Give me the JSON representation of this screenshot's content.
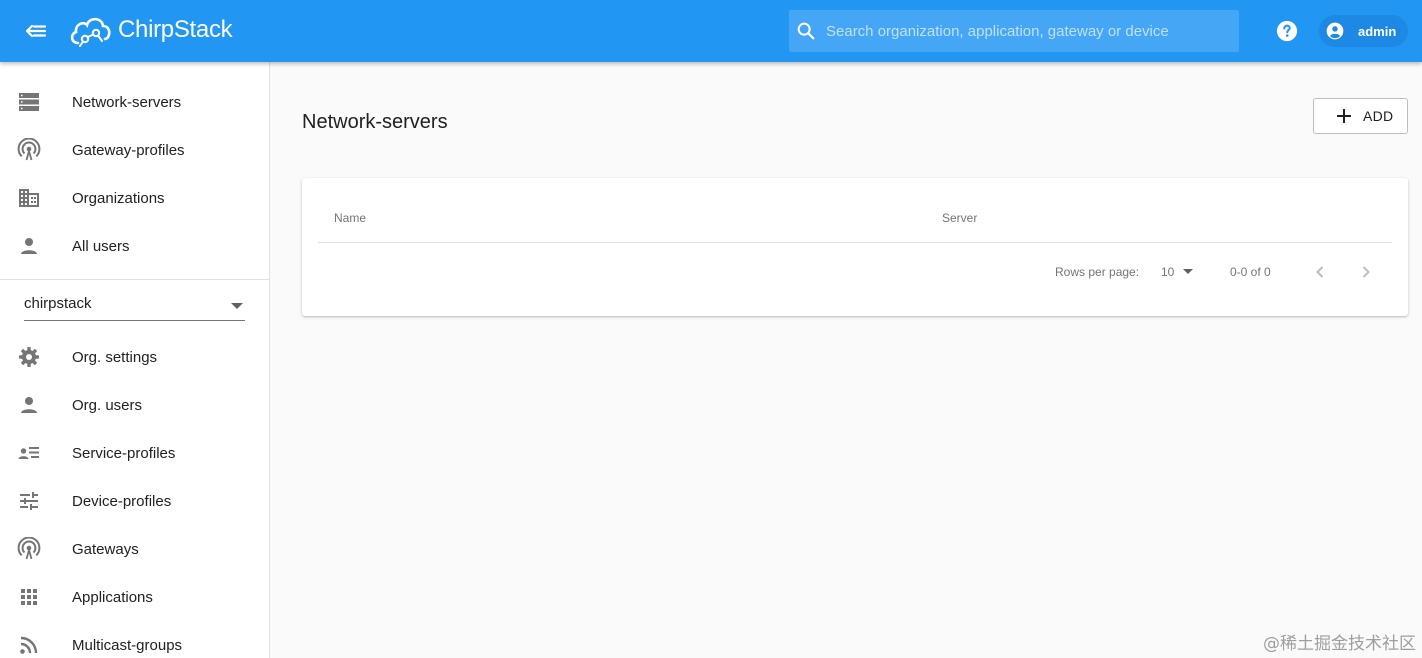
{
  "app": {
    "brand": "ChirpStack",
    "colors": {
      "appbar": "#2196f3",
      "search_bg": "#45a6f5",
      "user_chip": "#1e88e5",
      "icon_gray": "#757575"
    }
  },
  "header": {
    "search_placeholder": "Search organization, application, gateway or device",
    "user_label": "admin",
    "icons": [
      "menu-collapse-icon",
      "chirpstack-logo",
      "search-icon",
      "help-icon",
      "account-icon"
    ]
  },
  "sidebar": {
    "admin_items": [
      {
        "label": "Network-servers",
        "icon": "server-icon"
      },
      {
        "label": "Gateway-profiles",
        "icon": "access-point-icon"
      },
      {
        "label": "Organizations",
        "icon": "domain-icon"
      },
      {
        "label": "All users",
        "icon": "person-icon"
      }
    ],
    "org_select": {
      "value": "chirpstack"
    },
    "org_items": [
      {
        "label": "Org. settings",
        "icon": "gear-icon"
      },
      {
        "label": "Org. users",
        "icon": "person-icon"
      },
      {
        "label": "Service-profiles",
        "icon": "account-details-icon"
      },
      {
        "label": "Device-profiles",
        "icon": "tune-icon"
      },
      {
        "label": "Gateways",
        "icon": "access-point-icon"
      },
      {
        "label": "Applications",
        "icon": "apps-icon"
      },
      {
        "label": "Multicast-groups",
        "icon": "rss-icon"
      }
    ]
  },
  "main": {
    "title": "Network-servers",
    "add_label": "ADD",
    "table": {
      "columns": [
        "Name",
        "Server"
      ],
      "rows": [],
      "rows_per_page_label": "Rows per page:",
      "rows_per_page_value": "10",
      "range_label": "0-0 of 0"
    }
  },
  "watermark": "@稀土掘金技术社区"
}
